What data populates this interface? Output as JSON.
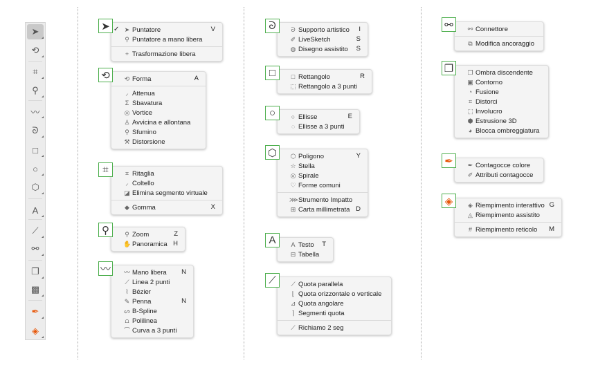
{
  "colors": {
    "highlight": "#4cae4c",
    "accent_fill": "#e8590c"
  },
  "toolbar": {
    "tools": [
      {
        "icon": "pointer-icon",
        "glyph": "➤",
        "active": true
      },
      {
        "icon": "shape-icon",
        "glyph": "⟲"
      },
      {
        "icon": "crop-icon",
        "glyph": "⌗"
      },
      {
        "icon": "zoom-icon",
        "glyph": "⚲"
      },
      {
        "icon": "freehand-icon",
        "glyph": "〰"
      },
      {
        "icon": "artistic-media-icon",
        "glyph": "ᘐ"
      },
      {
        "icon": "rectangle-icon",
        "glyph": "□"
      },
      {
        "icon": "ellipse-icon",
        "glyph": "○"
      },
      {
        "icon": "polygon-icon",
        "glyph": "⬡"
      },
      {
        "icon": "text-icon",
        "glyph": "A"
      },
      {
        "icon": "dimension-icon",
        "glyph": "⟋"
      },
      {
        "icon": "connector-icon",
        "glyph": "⚯"
      },
      {
        "icon": "drop-shadow-icon",
        "glyph": "❐"
      },
      {
        "icon": "transparency-icon",
        "glyph": "▩"
      },
      {
        "icon": "eyedropper-icon",
        "glyph": "✒"
      },
      {
        "icon": "interactive-fill-icon",
        "glyph": "◈"
      }
    ]
  },
  "flyouts": [
    {
      "icon": "pointer-icon",
      "glyph": "➤",
      "items": [
        {
          "label": "Puntatore",
          "shortcut": "V",
          "icon": "pointer-icon",
          "glyph": "➤",
          "checked": true
        },
        {
          "label": "Puntatore a mano libera",
          "icon": "freehand-pick-icon",
          "glyph": "⚲"
        },
        {
          "sep": true
        },
        {
          "label": "Trasformazione libera",
          "icon": "free-transform-icon",
          "glyph": "+"
        }
      ]
    },
    {
      "icon": "shape-icon",
      "glyph": "⟲",
      "items": [
        {
          "label": "Forma",
          "shortcut": "A",
          "icon": "shape-icon",
          "glyph": "⟲"
        },
        {
          "sep": true
        },
        {
          "label": "Attenua",
          "icon": "smooth-icon",
          "glyph": "⸝"
        },
        {
          "label": "Sbavatura",
          "icon": "smear-icon",
          "glyph": "Σ"
        },
        {
          "label": "Vortice",
          "icon": "twirl-icon",
          "glyph": "◎"
        },
        {
          "label": "Avvicina e allontana",
          "icon": "attract-repel-icon",
          "glyph": "♙"
        },
        {
          "label": "Sfumino",
          "icon": "smudge-icon",
          "glyph": "⚲"
        },
        {
          "label": "Distorsione",
          "icon": "roughen-icon",
          "glyph": "⚒"
        }
      ]
    },
    {
      "icon": "crop-icon",
      "glyph": "⌗",
      "items": [
        {
          "label": "Ritaglia",
          "icon": "crop-icon",
          "glyph": "⌗"
        },
        {
          "label": "Coltello",
          "icon": "knife-icon",
          "glyph": "⸝"
        },
        {
          "label": "Elimina segmento virtuale",
          "icon": "virtual-segment-delete-icon",
          "glyph": "◪"
        },
        {
          "sep": true
        },
        {
          "label": "Gomma",
          "shortcut": "X",
          "icon": "eraser-icon",
          "glyph": "◆"
        }
      ]
    },
    {
      "icon": "zoom-icon",
      "glyph": "⚲",
      "items": [
        {
          "label": "Zoom",
          "shortcut": "Z",
          "icon": "zoom-icon",
          "glyph": "⚲"
        },
        {
          "label": "Panoramica",
          "shortcut": "H",
          "icon": "pan-icon",
          "glyph": "✋"
        }
      ]
    },
    {
      "icon": "freehand-icon",
      "glyph": "〰",
      "items": [
        {
          "label": "Mano libera",
          "shortcut": "N",
          "icon": "freehand-icon",
          "glyph": "〰"
        },
        {
          "label": "Linea 2 punti",
          "icon": "two-point-line-icon",
          "glyph": "⟋"
        },
        {
          "label": "Bézier",
          "icon": "bezier-icon",
          "glyph": "⌇"
        },
        {
          "label": "Penna",
          "shortcut": "N",
          "icon": "pen-icon",
          "glyph": "✎"
        },
        {
          "label": "B-Spline",
          "icon": "bspline-icon",
          "glyph": "ᔕ"
        },
        {
          "label": "Polilinea",
          "icon": "polyline-icon",
          "glyph": "⩍"
        },
        {
          "label": "Curva a 3 punti",
          "icon": "three-point-curve-icon",
          "glyph": "⌒"
        }
      ]
    },
    {
      "icon": "artistic-media-icon",
      "glyph": "ᘐ",
      "items": [
        {
          "label": "Supporto artistico",
          "shortcut": "I",
          "icon": "artistic-media-icon",
          "glyph": "ᘐ"
        },
        {
          "label": "LiveSketch",
          "shortcut": "S",
          "icon": "livesketch-icon",
          "glyph": "✐"
        },
        {
          "label": "Disegno assistito",
          "shortcut": "S",
          "icon": "smart-drawing-icon",
          "glyph": "◍"
        }
      ]
    },
    {
      "icon": "rectangle-icon",
      "glyph": "□",
      "items": [
        {
          "label": "Rettangolo",
          "shortcut": "R",
          "icon": "rectangle-icon",
          "glyph": "□"
        },
        {
          "label": "Rettangolo a 3 punti",
          "icon": "three-point-rectangle-icon",
          "glyph": "⬚"
        }
      ]
    },
    {
      "icon": "ellipse-icon",
      "glyph": "○",
      "items": [
        {
          "label": "Ellisse",
          "shortcut": "E",
          "icon": "ellipse-icon",
          "glyph": "○"
        },
        {
          "label": "Ellisse a 3 punti",
          "icon": "three-point-ellipse-icon",
          "glyph": "◌"
        }
      ]
    },
    {
      "icon": "polygon-icon",
      "glyph": "⬡",
      "items": [
        {
          "label": "Poligono",
          "shortcut": "Y",
          "icon": "polygon-icon",
          "glyph": "⬡"
        },
        {
          "label": "Stella",
          "icon": "star-icon",
          "glyph": "☆"
        },
        {
          "label": "Spirale",
          "icon": "spiral-icon",
          "glyph": "◎"
        },
        {
          "label": "Forme comuni",
          "icon": "common-shapes-icon",
          "glyph": "♡"
        },
        {
          "sep": true
        },
        {
          "label": "Strumento Impatto",
          "icon": "impact-icon",
          "glyph": "⋙"
        },
        {
          "label": "Carta millimetrata",
          "shortcut": "D",
          "icon": "graph-paper-icon",
          "glyph": "⊞"
        }
      ]
    },
    {
      "icon": "text-icon",
      "glyph": "A",
      "items": [
        {
          "label": "Testo",
          "shortcut": "T",
          "icon": "text-icon",
          "glyph": "A"
        },
        {
          "label": "Tabella",
          "icon": "table-icon",
          "glyph": "⊟"
        }
      ]
    },
    {
      "icon": "dimension-icon",
      "glyph": "⟋",
      "items": [
        {
          "label": "Quota parallela",
          "icon": "parallel-dimension-icon",
          "glyph": "⟋"
        },
        {
          "label": "Quota orizzontale o verticale",
          "icon": "horizontal-vertical-dimension-icon",
          "glyph": "⌊"
        },
        {
          "label": "Quota angolare",
          "icon": "angular-dimension-icon",
          "glyph": "⊿"
        },
        {
          "label": "Segmenti quota",
          "icon": "segment-dimension-icon",
          "glyph": "⌉"
        },
        {
          "sep": true
        },
        {
          "label": "Richiamo 2 seg",
          "icon": "callout-icon",
          "glyph": "⟋"
        }
      ]
    },
    {
      "icon": "connector-icon",
      "glyph": "⚯",
      "items": [
        {
          "label": "Connettore",
          "icon": "connector-icon",
          "glyph": "⚯"
        },
        {
          "sep": true
        },
        {
          "label": "Modifica ancoraggio",
          "icon": "edit-anchor-icon",
          "glyph": "⧉"
        }
      ]
    },
    {
      "icon": "drop-shadow-icon",
      "glyph": "❐",
      "items": [
        {
          "label": "Ombra discendente",
          "icon": "drop-shadow-icon",
          "glyph": "❐"
        },
        {
          "label": "Contorno",
          "icon": "contour-icon",
          "glyph": "▣"
        },
        {
          "label": "Fusione",
          "icon": "blend-icon",
          "glyph": "◔"
        },
        {
          "label": "Distorci",
          "icon": "distort-icon",
          "glyph": "⌗"
        },
        {
          "label": "Involucro",
          "icon": "envelope-icon",
          "glyph": "⬚"
        },
        {
          "label": "Estrusione 3D",
          "icon": "extrude-icon",
          "glyph": "⬢"
        },
        {
          "label": "Blocca ombreggiatura",
          "icon": "block-shadow-icon",
          "glyph": "◕"
        }
      ]
    },
    {
      "icon": "eyedropper-icon",
      "glyph": "✒",
      "items": [
        {
          "label": "Contagocce colore",
          "icon": "color-eyedropper-icon",
          "glyph": "✒"
        },
        {
          "label": "Attributi contagocce",
          "icon": "attributes-eyedropper-icon",
          "glyph": "✐"
        }
      ]
    },
    {
      "icon": "interactive-fill-icon",
      "glyph": "◈",
      "items": [
        {
          "label": "Riempimento interattivo",
          "shortcut": "G",
          "icon": "interactive-fill-icon",
          "glyph": "◈"
        },
        {
          "label": "Riempimento assistito",
          "icon": "smart-fill-icon",
          "glyph": "◬"
        },
        {
          "sep": true
        },
        {
          "label": "Riempimento reticolo",
          "shortcut": "M",
          "icon": "mesh-fill-icon",
          "glyph": "#"
        }
      ]
    }
  ]
}
